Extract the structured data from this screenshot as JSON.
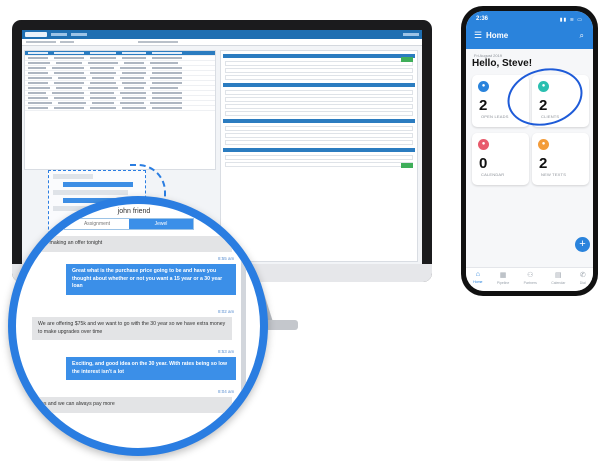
{
  "phone": {
    "time": "2:36",
    "status": "▮▮ ≋ ▭",
    "title": "Home",
    "date": "Fri August 2019",
    "greeting": "Hello, Steve!",
    "cards": [
      {
        "label": "OPEN LEADS",
        "value": "2",
        "color": "#2a83dc"
      },
      {
        "label": "CLIENTS",
        "value": "2",
        "color": "#2bbfb0"
      },
      {
        "label": "CALENDAR",
        "value": "0",
        "color": "#e85a6c"
      },
      {
        "label": "NEW TEXTS",
        "value": "2",
        "color": "#f39c3a"
      }
    ],
    "fab_label": "+",
    "tabs": [
      {
        "label": "Home",
        "icon": "home-icon"
      },
      {
        "label": "Pipeline",
        "icon": "pipeline-icon"
      },
      {
        "label": "Partners",
        "icon": "partners-icon"
      },
      {
        "label": "Calendar",
        "icon": "calendar-icon"
      },
      {
        "label": "Dial",
        "icon": "dial-icon"
      }
    ]
  },
  "chat": {
    "contact": "john friend",
    "segments": [
      "Assignment",
      "Jewel"
    ],
    "messages": [
      {
        "dir": "in",
        "text": "I am making an offer tonight"
      },
      {
        "dir": "time",
        "text": "8:55 am"
      },
      {
        "dir": "out",
        "text": "Great what is the purchase price going to be and have you thought about whether or not you want a 15 year or a 30 year loan"
      },
      {
        "dir": "time",
        "text": "8:02 am"
      },
      {
        "dir": "in",
        "text": "We are offering $75k and we want to go with the 30 year so we have extra money to make upgrades over time"
      },
      {
        "dir": "time",
        "text": "8:53 am"
      },
      {
        "dir": "out",
        "text": "Exciting, and good idea on the 30 year. With rates being so low the interest isn't a lot"
      },
      {
        "dir": "time",
        "text": "8:04 am"
      },
      {
        "dir": "in",
        "text": "Yes and we can always pay more"
      }
    ]
  }
}
